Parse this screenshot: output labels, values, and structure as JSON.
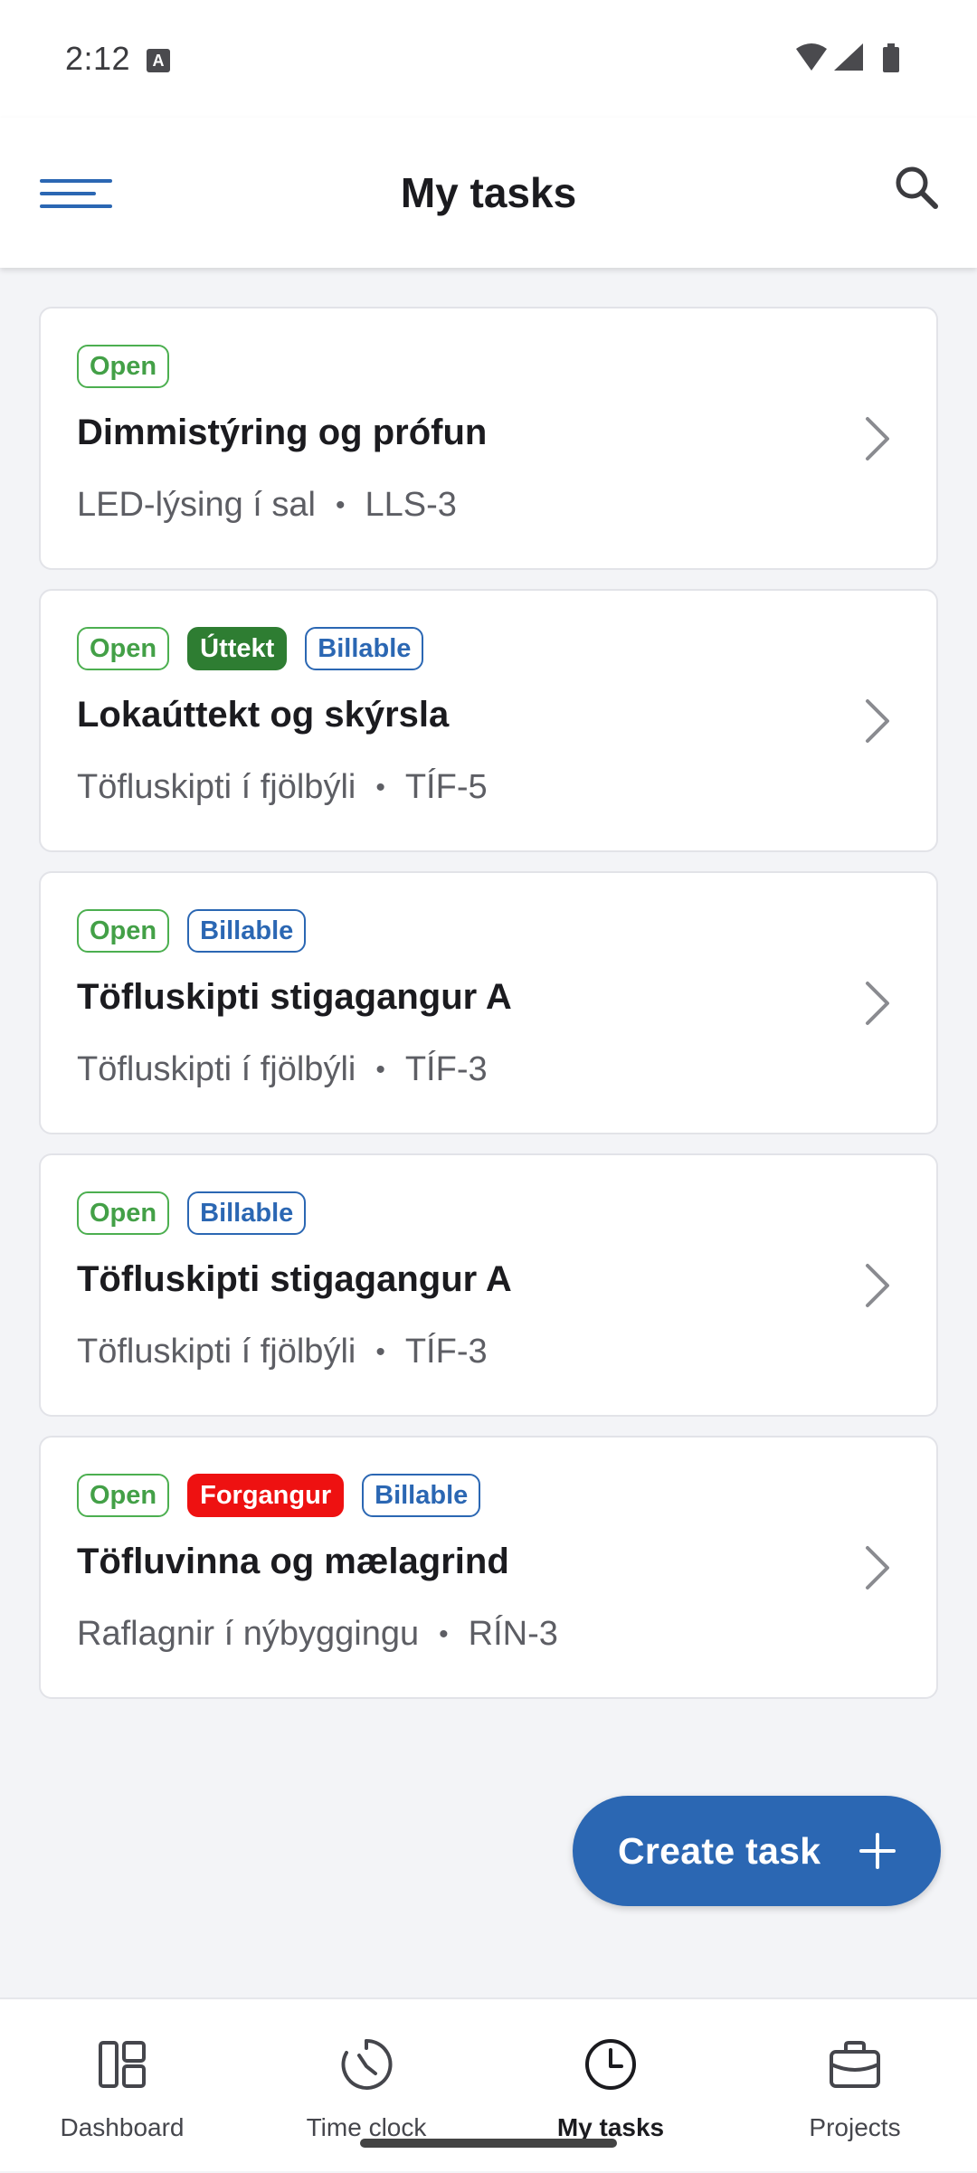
{
  "status_bar": {
    "time": "2:12",
    "icons": [
      "a-icon",
      "wifi-icon",
      "signal-icon",
      "battery-icon"
    ]
  },
  "app_bar": {
    "title": "My tasks",
    "menu_icon": "menu-icon",
    "search_icon": "search-icon"
  },
  "tasks": [
    {
      "badges": [
        {
          "label": "Open",
          "type": "open"
        }
      ],
      "title": "Dimmistýring og prófun",
      "project": "LED-lýsing í sal",
      "code": "LLS-3"
    },
    {
      "badges": [
        {
          "label": "Open",
          "type": "open"
        },
        {
          "label": "Úttekt",
          "type": "uttekt"
        },
        {
          "label": "Billable",
          "type": "billable"
        }
      ],
      "title": "Lokaúttekt og skýrsla",
      "project": "Töfluskipti í fjölbýli",
      "code": "TÍF-5"
    },
    {
      "badges": [
        {
          "label": "Open",
          "type": "open"
        },
        {
          "label": "Billable",
          "type": "billable"
        }
      ],
      "title": "Töfluskipti stigagangur A",
      "project": "Töfluskipti í fjölbýli",
      "code": "TÍF-3"
    },
    {
      "badges": [
        {
          "label": "Open",
          "type": "open"
        },
        {
          "label": "Billable",
          "type": "billable"
        }
      ],
      "title": "Töfluskipti stigagangur A",
      "project": "Töfluskipti í fjölbýli",
      "code": "TÍF-3"
    },
    {
      "badges": [
        {
          "label": "Open",
          "type": "open"
        },
        {
          "label": "Forgangur",
          "type": "forgangur"
        },
        {
          "label": "Billable",
          "type": "billable"
        }
      ],
      "title": "Töfluvinna og mælagrind",
      "project": "Raflagnir í nýbyggingu",
      "code": "RÍN-3"
    }
  ],
  "fab": {
    "label": "Create task",
    "icon": "plus-icon"
  },
  "bottom_nav": [
    {
      "label": "Dashboard",
      "icon": "dashboard-icon",
      "active": false
    },
    {
      "label": "Time clock",
      "icon": "time-clock-icon",
      "active": false
    },
    {
      "label": "My tasks",
      "icon": "clock-icon",
      "active": true
    },
    {
      "label": "Projects",
      "icon": "briefcase-icon",
      "active": false
    }
  ],
  "colors": {
    "primary": "#2b67b3",
    "open_green": "#43a047",
    "uttekt_green": "#2e7d32",
    "forgangur_red": "#ee1111",
    "background": "#f3f4f7"
  }
}
